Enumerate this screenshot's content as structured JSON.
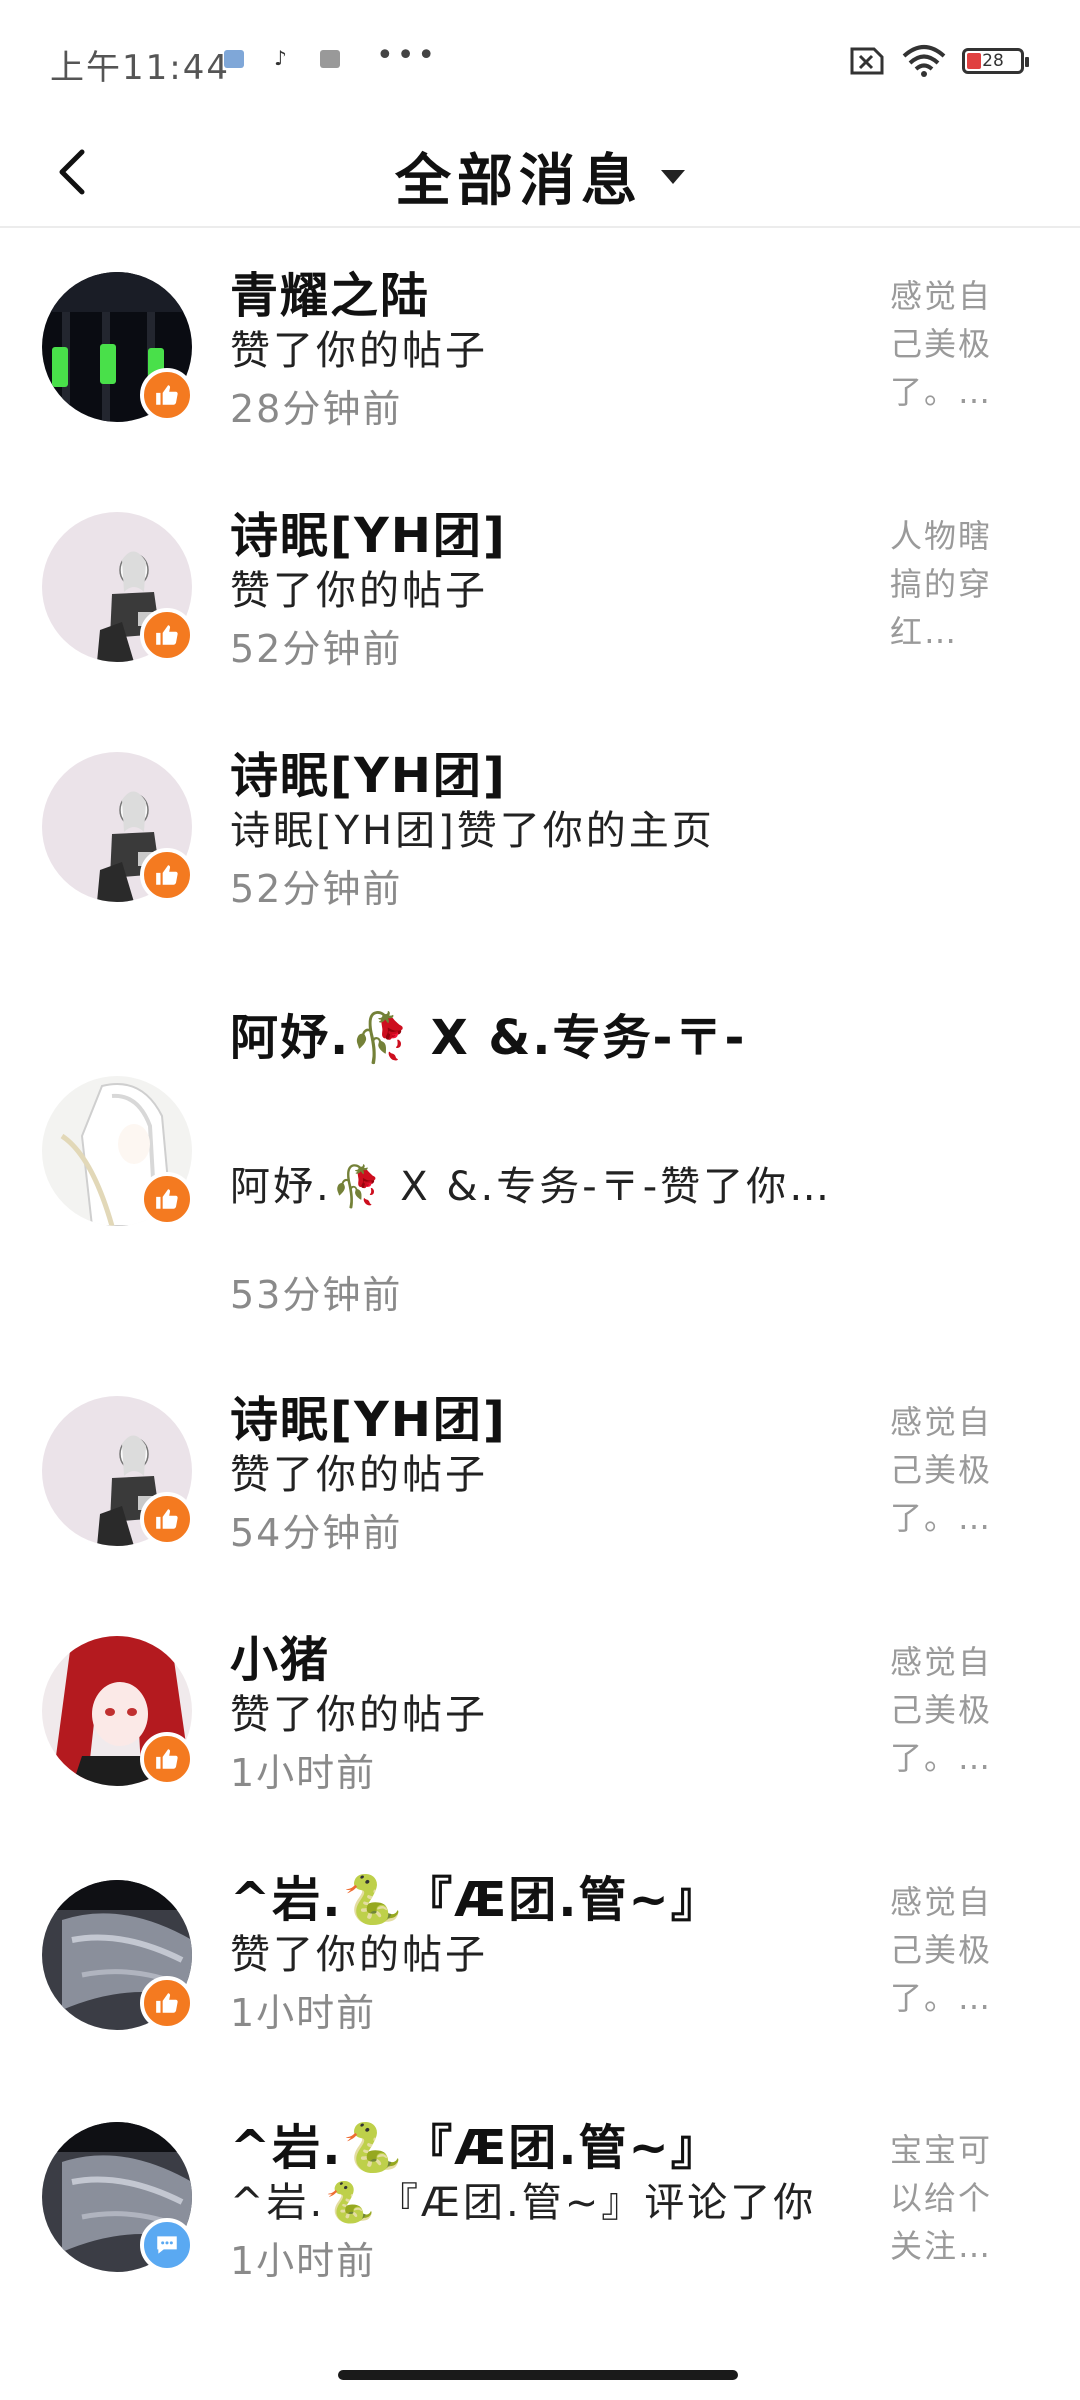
{
  "status_bar": {
    "time": "上午11:44",
    "dots": "•••",
    "battery": "28"
  },
  "header": {
    "title": "全部消息"
  },
  "messages": [
    {
      "name": "青耀之陆",
      "action": "赞了你的帖子",
      "time": "28分钟前",
      "preview": "感觉自己美极了。…",
      "badge": "like"
    },
    {
      "name": "诗眠[YH团]",
      "action": "赞了你的帖子",
      "time": "52分钟前",
      "preview": "人物瞎搞的穿红…",
      "badge": "like"
    },
    {
      "name": "诗眠[YH团]",
      "action": "诗眠[YH团]赞了你的主页",
      "time": "52分钟前",
      "preview": "",
      "badge": "like"
    },
    {
      "name": "阿妤.🥀 X &.专务-〒-",
      "action": "阿妤.🥀 X &.专务-〒-赞了你的…",
      "time": "53分钟前",
      "preview": "",
      "badge": "like"
    },
    {
      "name": "诗眠[YH团]",
      "action": "赞了你的帖子",
      "time": "54分钟前",
      "preview": "感觉自己美极了。…",
      "badge": "like"
    },
    {
      "name": "小猪",
      "action": "赞了你的帖子",
      "time": "1小时前",
      "preview": "感觉自己美极了。…",
      "badge": "like"
    },
    {
      "name": "^岩.🐍『Æ团.管~』",
      "action": "赞了你的帖子",
      "time": "1小时前",
      "preview": "感觉自己美极了。…",
      "badge": "like"
    },
    {
      "name": "^岩.🐍『Æ团.管~』",
      "action": "^岩.🐍『Æ团.管~』评论了你",
      "time": "1小时前",
      "preview": "宝宝可以给个关注…",
      "badge": "comment"
    }
  ]
}
